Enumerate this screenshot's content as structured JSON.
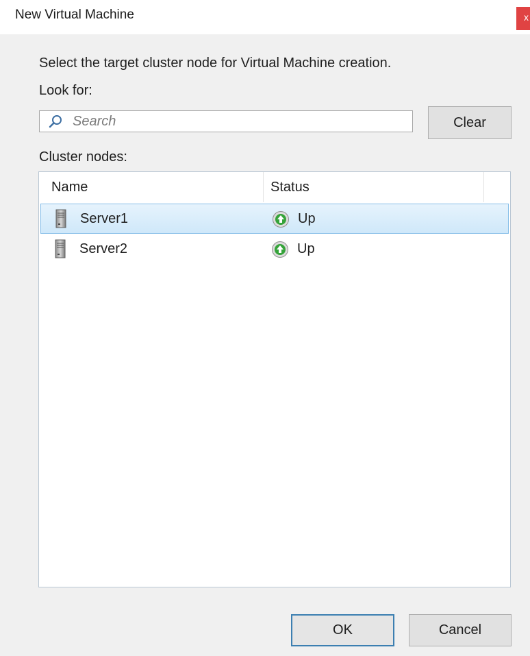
{
  "window": {
    "title": "New Virtual Machine",
    "close_glyph": "x"
  },
  "dialog": {
    "instruction": "Select the target cluster node for Virtual Machine creation.",
    "look_for_label": "Look for:",
    "search": {
      "placeholder": "Search",
      "value": "",
      "icon": "search-icon"
    },
    "clear_label": "Clear",
    "cluster_nodes_label": "Cluster nodes:",
    "table": {
      "columns": [
        "Name",
        "Status"
      ],
      "rows": [
        {
          "name": "Server1",
          "status": "Up",
          "selected": true,
          "icon": "server-icon",
          "status_icon": "status-up-icon"
        },
        {
          "name": "Server2",
          "status": "Up",
          "selected": false,
          "icon": "server-icon",
          "status_icon": "status-up-icon"
        }
      ]
    },
    "ok_label": "OK",
    "cancel_label": "Cancel"
  },
  "colors": {
    "close_button": "#e04343",
    "selection_fill": "#cfe8fa",
    "selection_border": "#84bde8",
    "status_up_green": "#35a33a",
    "default_button_border": "#3c7fb1"
  }
}
